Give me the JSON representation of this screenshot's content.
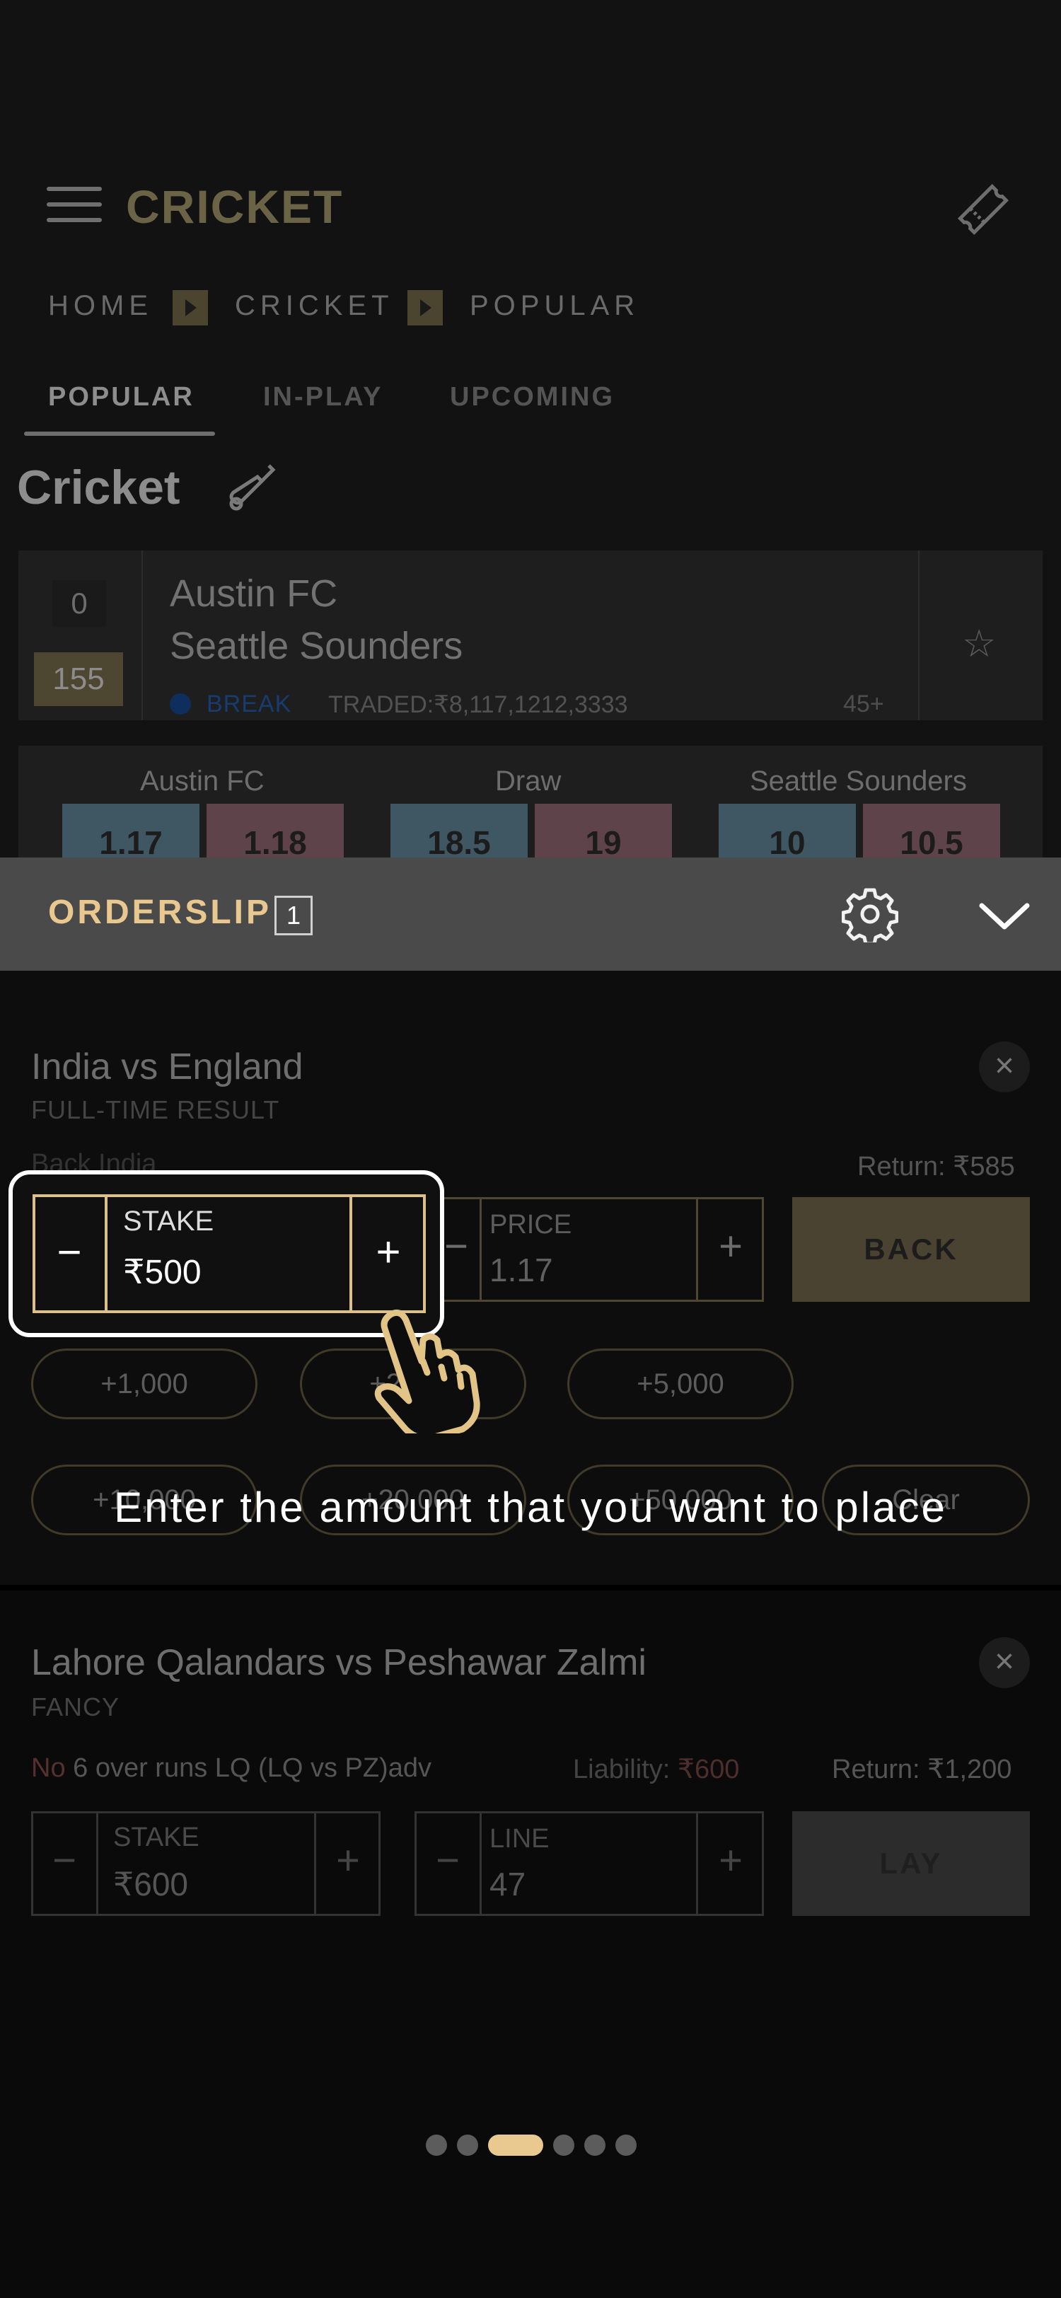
{
  "header": {
    "title": "CRICKET"
  },
  "breadcrumb": [
    "HOME",
    "CRICKET",
    "POPULAR"
  ],
  "tabs": [
    {
      "label": "POPULAR",
      "active": true
    },
    {
      "label": "IN-PLAY",
      "active": false
    },
    {
      "label": "UPCOMING",
      "active": false
    }
  ],
  "section": {
    "title": "Cricket"
  },
  "match": {
    "score_top": "0",
    "score_bottom": "155",
    "team1": "Austin FC",
    "team2": "Seattle Sounders",
    "status": "BREAK",
    "traded": "TRADED:₹8,117,1212,3333",
    "more": "45+"
  },
  "odds": {
    "columns": [
      {
        "name": "Austin FC",
        "back": "1.17",
        "lay": "1.18"
      },
      {
        "name": "Draw",
        "back": "18.5",
        "lay": "19"
      },
      {
        "name": "Seattle Sounders",
        "back": "10",
        "lay": "10.5"
      }
    ]
  },
  "orderslip": {
    "title": "ORDERSLIP",
    "count": "1",
    "bet1": {
      "match": "India vs England",
      "market": "FULL-TIME RESULT",
      "selection": "Back India",
      "return": "Return: ₹585",
      "stake_label": "STAKE",
      "stake_value": "₹500",
      "price_label": "PRICE",
      "price_value": "1.17",
      "action": "BACK",
      "chips": [
        "+1,000",
        "+2,000",
        "+5,000",
        "+10,000",
        "+20,000",
        "+50,000",
        "Clear"
      ]
    },
    "bet2": {
      "match": "Lahore Qalandars vs Peshawar Zalmi",
      "market": "FANCY",
      "side": "No",
      "selection": "6 over runs LQ (LQ vs PZ)adv",
      "liability_label": "Liability:",
      "liability_value": "₹600",
      "return": "Return: ₹1,200",
      "stake_label": "STAKE",
      "stake_value": "₹600",
      "line_label": "LINE",
      "line_value": "47",
      "action": "LAY"
    }
  },
  "tutorial": {
    "instruction": "Enter the amount that you want to place",
    "pages": 6,
    "active_page": 3
  },
  "symbols": {
    "minus": "−",
    "plus": "+",
    "close": "×",
    "star": "☆"
  },
  "colors": {
    "accent": "#e9c98f",
    "back": "#3f5663",
    "lay": "#5f434b",
    "break": "#0e2f5e"
  }
}
